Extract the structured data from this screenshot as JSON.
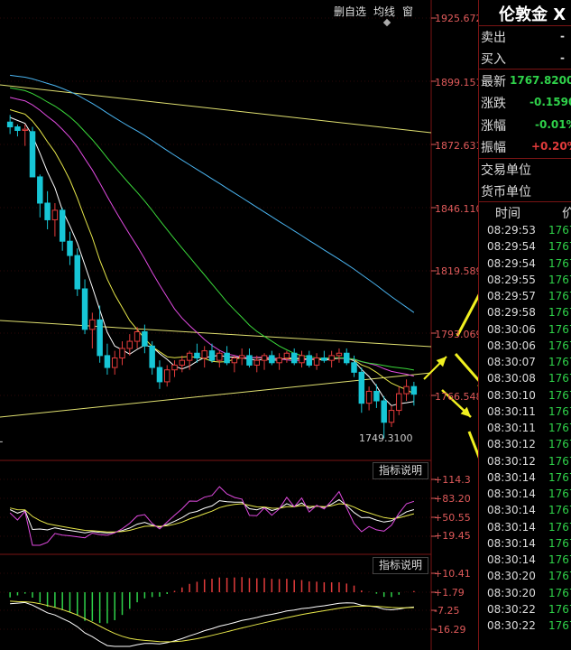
{
  "toolbar": {
    "btn1": "删自选",
    "btn2": "均线",
    "btn3": "窗"
  },
  "price_axis": [
    "1925.672",
    "1899.151",
    "1872.631",
    "1846.110",
    "1819.589",
    "1793.069",
    "1766.548"
  ],
  "macd_axis": [
    "+10.41",
    "+1.79",
    "-7.25",
    "-16.29"
  ],
  "kdj_axis": [
    "+114.3",
    "+83.20",
    "+50.55",
    "+19.45"
  ],
  "indicator_btn": "指标说明",
  "low_label": "1749.3100",
  "quote": {
    "title": "伦敦金",
    "title_suffix": "X",
    "sell_label": "卖出",
    "sell_value": "-",
    "buy_label": "买入",
    "buy_value": "-",
    "latest_label": "最新",
    "latest_value": "1767.8200",
    "change_label": "涨跌",
    "change_value": "-0.1590",
    "pct_label": "涨幅",
    "pct_value": "-0.01%",
    "amp_label": "振幅",
    "amp_value": "+0.20%",
    "unit_label": "交易单位",
    "currency_label": "货币单位"
  },
  "ticks_header": {
    "time": "时间",
    "price": "价"
  },
  "ticks": [
    {
      "time": "08:29:53",
      "price": "1767"
    },
    {
      "time": "08:29:54",
      "price": "1767"
    },
    {
      "time": "08:29:54",
      "price": "1767"
    },
    {
      "time": "08:29:55",
      "price": "1767"
    },
    {
      "time": "08:29:57",
      "price": "1767"
    },
    {
      "time": "08:29:58",
      "price": "1767"
    },
    {
      "time": "08:30:06",
      "price": "1767"
    },
    {
      "time": "08:30:06",
      "price": "1767"
    },
    {
      "time": "08:30:07",
      "price": "1767"
    },
    {
      "time": "08:30:08",
      "price": "1767"
    },
    {
      "time": "08:30:10",
      "price": "1767"
    },
    {
      "time": "08:30:11",
      "price": "1767"
    },
    {
      "time": "08:30:11",
      "price": "1767"
    },
    {
      "time": "08:30:12",
      "price": "1767"
    },
    {
      "time": "08:30:12",
      "price": "1767"
    },
    {
      "time": "08:30:14",
      "price": "1767"
    },
    {
      "time": "08:30:14",
      "price": "1767"
    },
    {
      "time": "08:30:14",
      "price": "1767"
    },
    {
      "time": "08:30:14",
      "price": "1767"
    },
    {
      "time": "08:30:14",
      "price": "1767"
    },
    {
      "time": "08:30:14",
      "price": "1767"
    },
    {
      "time": "08:30:20",
      "price": "1767"
    },
    {
      "time": "08:30:20",
      "price": "1767"
    },
    {
      "time": "08:30:22",
      "price": "1767"
    },
    {
      "time": "08:30:22",
      "price": "1767"
    }
  ],
  "colors": {
    "up": "#e23b3b",
    "down": "#17c6d6",
    "ma1": "#ffffff",
    "ma2": "#e8e84a",
    "ma3": "#e04ae0",
    "ma4": "#3ad83a",
    "ma5": "#4ab4f0",
    "trend": "#e0e070",
    "arrow": "#f0f020",
    "green": "#2fd24a"
  },
  "chart_data": {
    "type": "candlestick",
    "ylim": [
      1740.0,
      1925.672
    ],
    "low_marker": 1749.31,
    "candles": [
      [
        1882.0,
        1885.0,
        1877.0,
        1880.0
      ],
      [
        1880.0,
        1881.0,
        1876.0,
        1878.5
      ],
      [
        1878.5,
        1881.0,
        1872.0,
        1879.0
      ],
      [
        1878.0,
        1880.0,
        1868.0,
        1859.0
      ],
      [
        1859.0,
        1860.0,
        1842.0,
        1848.0
      ],
      [
        1848.0,
        1853.0,
        1837.0,
        1841.0
      ],
      [
        1841.0,
        1848.0,
        1834.0,
        1845.0
      ],
      [
        1845.0,
        1846.0,
        1828.0,
        1832.0
      ],
      [
        1832.0,
        1836.0,
        1822.0,
        1826.0
      ],
      [
        1826.0,
        1829.0,
        1809.0,
        1812.0
      ],
      [
        1812.0,
        1816.0,
        1793.0,
        1795.0
      ],
      [
        1795.0,
        1802.0,
        1787.0,
        1799.0
      ],
      [
        1799.0,
        1805.0,
        1781.0,
        1784.0
      ],
      [
        1784.0,
        1789.0,
        1776.0,
        1779.0
      ],
      [
        1779.0,
        1786.0,
        1776.0,
        1783.0
      ],
      [
        1783.0,
        1790.0,
        1780.0,
        1787.0
      ],
      [
        1787.0,
        1793.0,
        1784.0,
        1790.0
      ],
      [
        1790.0,
        1796.0,
        1787.0,
        1794.0
      ],
      [
        1794.0,
        1797.0,
        1785.0,
        1788.0
      ],
      [
        1788.0,
        1790.0,
        1776.0,
        1779.0
      ],
      [
        1779.0,
        1782.0,
        1770.0,
        1773.0
      ],
      [
        1773.0,
        1780.0,
        1771.0,
        1778.0
      ],
      [
        1778.0,
        1782.0,
        1775.0,
        1780.0
      ],
      [
        1780.0,
        1784.0,
        1777.0,
        1782.0
      ],
      [
        1782.0,
        1786.0,
        1778.0,
        1785.0
      ],
      [
        1785.0,
        1789.0,
        1781.0,
        1783.0
      ],
      [
        1783.0,
        1788.0,
        1779.0,
        1786.0
      ],
      [
        1786.0,
        1789.0,
        1781.0,
        1782.0
      ],
      [
        1782.0,
        1786.0,
        1779.0,
        1785.0
      ],
      [
        1785.0,
        1788.0,
        1780.0,
        1781.0
      ],
      [
        1781.0,
        1784.0,
        1777.0,
        1783.0
      ],
      [
        1783.0,
        1787.0,
        1780.0,
        1784.0
      ],
      [
        1784.0,
        1787.0,
        1779.0,
        1780.0
      ],
      [
        1780.0,
        1784.0,
        1777.0,
        1782.0
      ],
      [
        1782.0,
        1785.0,
        1778.0,
        1784.0
      ],
      [
        1784.0,
        1786.0,
        1780.0,
        1781.0
      ],
      [
        1781.0,
        1785.0,
        1778.0,
        1783.0
      ],
      [
        1783.0,
        1786.0,
        1781.0,
        1785.0
      ],
      [
        1785.0,
        1787.0,
        1780.0,
        1781.0
      ],
      [
        1781.0,
        1786.0,
        1779.0,
        1784.0
      ],
      [
        1784.0,
        1786.0,
        1779.0,
        1780.0
      ],
      [
        1780.0,
        1785.0,
        1778.0,
        1783.0
      ],
      [
        1783.0,
        1786.0,
        1781.0,
        1782.0
      ],
      [
        1782.0,
        1786.0,
        1779.0,
        1784.0
      ],
      [
        1784.0,
        1787.0,
        1781.0,
        1785.0
      ],
      [
        1785.0,
        1787.0,
        1780.0,
        1781.0
      ],
      [
        1781.0,
        1784.0,
        1775.0,
        1777.0
      ],
      [
        1777.0,
        1779.0,
        1760.0,
        1764.0
      ],
      [
        1764.0,
        1771.0,
        1761.0,
        1769.0
      ],
      [
        1769.0,
        1772.0,
        1762.0,
        1765.0
      ],
      [
        1765.0,
        1767.0,
        1749.3,
        1756.0
      ],
      [
        1756.0,
        1763.0,
        1754.0,
        1761.0
      ],
      [
        1761.0,
        1771.0,
        1759.0,
        1768.0
      ],
      [
        1768.0,
        1774.0,
        1765.0,
        1771.0
      ],
      [
        1771.0,
        1773.0,
        1763.0,
        1767.8
      ]
    ]
  }
}
